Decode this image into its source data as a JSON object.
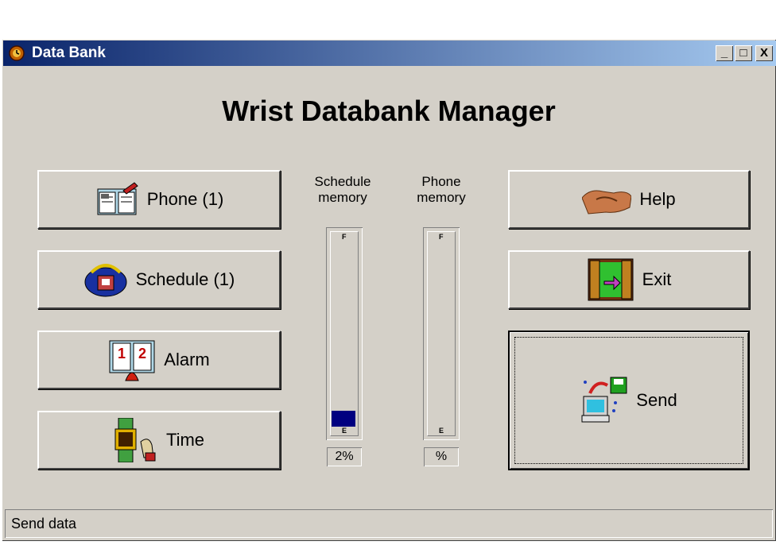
{
  "window": {
    "title": "Data Bank",
    "app_icon": "world-clock-icon"
  },
  "title_buttons": {
    "minimize": "_",
    "maximize": "□",
    "close": "X"
  },
  "heading": "Wrist Databank Manager",
  "buttons": {
    "phone": {
      "label": "Phone  (1)",
      "icon": "address-book-icon"
    },
    "schedule": {
      "label": "Schedule (1)",
      "icon": "globe-phone-icon"
    },
    "alarm": {
      "label": "Alarm",
      "icon": "calendar-bell-icon"
    },
    "time": {
      "label": "Time",
      "icon": "watch-icon"
    },
    "help": {
      "label": "Help",
      "icon": "handshake-icon"
    },
    "exit": {
      "label": "Exit",
      "icon": "door-exit-icon"
    },
    "send": {
      "label": "Send",
      "icon": "computer-send-icon"
    }
  },
  "memory": {
    "schedule": {
      "label_line1": "Schedule",
      "label_line2": "memory",
      "percent_text": "2%",
      "fill_fraction": 0.02,
      "full_mark": "F",
      "empty_mark": "E"
    },
    "phone": {
      "label_line1": "Phone",
      "label_line2": "memory",
      "percent_text": "%",
      "fill_fraction": 0,
      "full_mark": "F",
      "empty_mark": "E"
    }
  },
  "status": "Send data",
  "colors": {
    "title_start": "#0a246a",
    "title_end": "#a6caf0",
    "face": "#d4d0c8",
    "gauge_fill": "#000080"
  }
}
